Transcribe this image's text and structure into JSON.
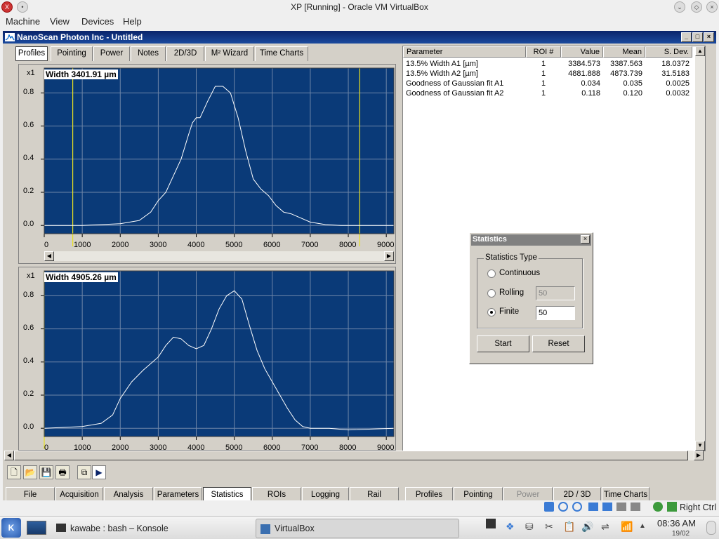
{
  "host": {
    "title": "XP [Running] - Oracle VM VirtualBox",
    "menu": [
      "Machine",
      "View",
      "Devices",
      "Help"
    ],
    "status_right": "Right Ctrl"
  },
  "app": {
    "title": "NanoScan Photon Inc - Untitled",
    "tabs": [
      "Profiles",
      "Pointing",
      "Power",
      "Notes",
      "2D/3D",
      "M² Wizard",
      "Time Charts"
    ],
    "active_tab": "Profiles"
  },
  "charts": {
    "top": {
      "multiplier": "x1",
      "width_label": "Width 3401.91 µm"
    },
    "bottom": {
      "multiplier": "x1",
      "width_label": "Width 4905.26 µm"
    },
    "y_ticks": [
      "0.8",
      "0.6",
      "0.4",
      "0.2",
      "0.0"
    ],
    "x_ticks": [
      "0",
      "1000",
      "2000",
      "3000",
      "4000",
      "5000",
      "6000",
      "7000",
      "8000",
      "9000"
    ]
  },
  "chart_data": [
    {
      "type": "line",
      "title": "Width 3401.91 µm",
      "xlim": [
        0,
        9200
      ],
      "ylim": [
        -0.05,
        0.95
      ],
      "markers_x": [
        750,
        8300
      ],
      "series": [
        {
          "x": [
            0,
            500,
            1000,
            1500,
            2000,
            2500,
            2800,
            3000,
            3200,
            3400,
            3600,
            3800,
            3900,
            4000,
            4100,
            4300,
            4500,
            4700,
            4900,
            5100,
            5300,
            5500,
            5700,
            5900,
            6100,
            6300,
            6500,
            6700,
            7000,
            7400,
            7800,
            8200,
            9200
          ],
          "y": [
            0.0,
            0.0,
            0.0,
            0.005,
            0.01,
            0.03,
            0.08,
            0.15,
            0.2,
            0.3,
            0.4,
            0.55,
            0.62,
            0.65,
            0.65,
            0.75,
            0.84,
            0.84,
            0.8,
            0.65,
            0.45,
            0.28,
            0.22,
            0.18,
            0.12,
            0.08,
            0.07,
            0.05,
            0.02,
            0.005,
            0.0,
            0.0,
            0.0
          ]
        }
      ]
    },
    {
      "type": "line",
      "title": "Width 4905.26 µm",
      "xlim": [
        0,
        9200
      ],
      "ylim": [
        -0.05,
        0.95
      ],
      "markers_x": [
        0
      ],
      "series": [
        {
          "x": [
            0,
            500,
            1000,
            1500,
            1800,
            2000,
            2300,
            2600,
            3000,
            3200,
            3400,
            3600,
            3800,
            4000,
            4200,
            4400,
            4600,
            4800,
            5000,
            5200,
            5400,
            5600,
            5800,
            6000,
            6200,
            6400,
            6600,
            6800,
            7000,
            7500,
            8000,
            9200
          ],
          "y": [
            0.0,
            0.005,
            0.01,
            0.03,
            0.08,
            0.18,
            0.28,
            0.35,
            0.43,
            0.5,
            0.55,
            0.54,
            0.5,
            0.48,
            0.5,
            0.6,
            0.72,
            0.8,
            0.83,
            0.78,
            0.62,
            0.47,
            0.36,
            0.28,
            0.2,
            0.12,
            0.05,
            0.01,
            0.0,
            0.0,
            -0.01,
            0.0
          ]
        }
      ]
    }
  ],
  "table": {
    "headers": [
      "Parameter",
      "ROI #",
      "Value",
      "Mean",
      "S. Dev."
    ],
    "rows": [
      [
        "13.5% Width A1 [µm]",
        "1",
        "3384.573",
        "3387.563",
        "18.0372"
      ],
      [
        "13.5% Width A2 [µm]",
        "1",
        "4881.888",
        "4873.739",
        "31.5183"
      ],
      [
        "Goodness of Gaussian fit A1",
        "1",
        "0.034",
        "0.035",
        "0.0025"
      ],
      [
        "Goodness of Gaussian fit A2",
        "1",
        "0.118",
        "0.120",
        "0.0032"
      ]
    ]
  },
  "statistics_dialog": {
    "title": "Statistics",
    "group_label": "Statistics Type",
    "options": [
      "Continuous",
      "Rolling",
      "Finite"
    ],
    "selected": "Finite",
    "rolling_value": "50",
    "finite_value": "50",
    "start_label": "Start",
    "reset_label": "Reset"
  },
  "bottom_tabs": [
    "File",
    "Acquisition",
    "Analysis",
    "Parameters",
    "Statistics",
    "ROIs",
    "Logging",
    "Rail"
  ],
  "bottom_tabs_right": [
    "Profiles",
    "Pointing",
    "Power",
    "2D / 3D",
    "Time Charts"
  ],
  "taskbar": {
    "items": [
      "kawabe : bash – Konsole",
      "VirtualBox"
    ],
    "time": "08:36 AM",
    "date": "19/02"
  },
  "colors": {
    "plot_bg": "#0a3a78",
    "curve": "#ffffff",
    "marker": "#e8e020",
    "grid": "#6f86a8",
    "titlebar": "#0a246a"
  }
}
